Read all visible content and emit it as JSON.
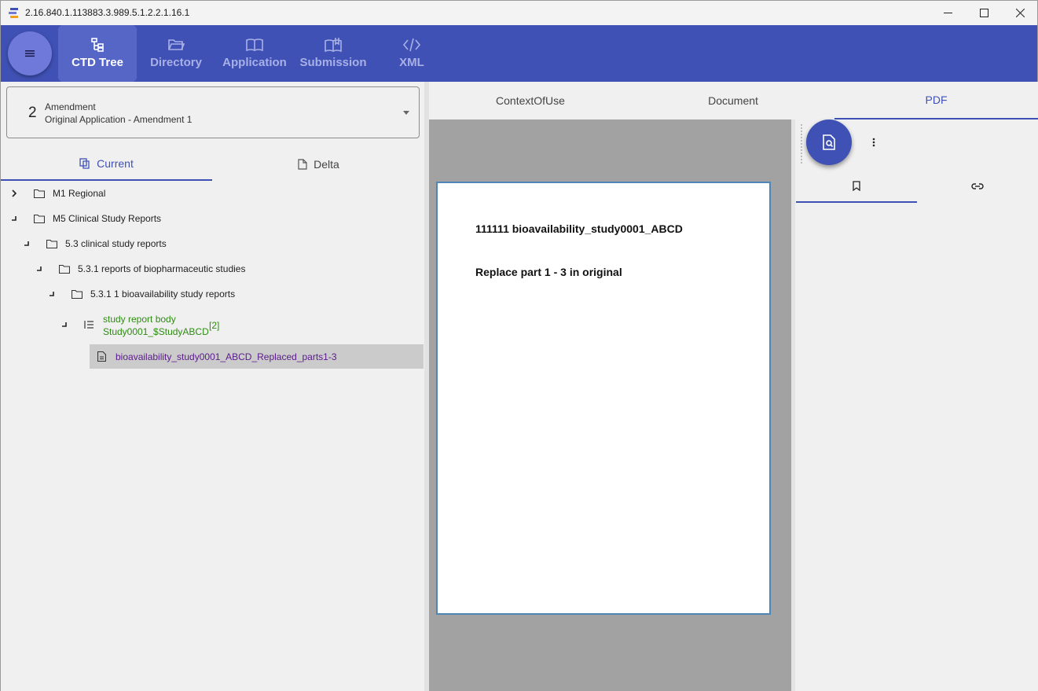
{
  "window": {
    "title": "2.16.840.1.113883.3.989.5.1.2.2.1.16.1"
  },
  "nav": {
    "items": [
      {
        "label": "CTD Tree",
        "icon": "tree-icon"
      },
      {
        "label": "Directory",
        "icon": "folder-open-icon"
      },
      {
        "label": "Application",
        "icon": "book-icon"
      },
      {
        "label": "Submission",
        "icon": "open-book-icon"
      },
      {
        "label": "XML",
        "icon": "code-icon"
      }
    ],
    "active": "CTD Tree"
  },
  "selector": {
    "number": "2",
    "type": "Amendment",
    "name": "Original Application - Amendment 1"
  },
  "left_tabs": {
    "current": "Current",
    "delta": "Delta"
  },
  "tree": {
    "m1": "M1 Regional",
    "m5": "M5 Clinical Study Reports",
    "s53": "5.3 clinical study reports",
    "s531": "5.3.1 reports of biopharmaceutic studies",
    "s5311": "5.3.1 1 bioavailability study reports",
    "study_line1": "study report body",
    "study_line2": "Study0001_$StudyABCD",
    "study_count": "[2]",
    "doc": "bioavailability_study0001_ABCD_Replaced_parts1-3"
  },
  "right_tabs": {
    "context": "ContextOfUse",
    "document": "Document",
    "pdf": "PDF"
  },
  "pdf": {
    "line1": "111111 bioavailability_study0001_ABCD",
    "line2": "Replace part 1 - 3 in original"
  },
  "colors": {
    "primary": "#3f51b5",
    "green_item": "#2e8b12",
    "purple_item": "#5b1a8c"
  }
}
